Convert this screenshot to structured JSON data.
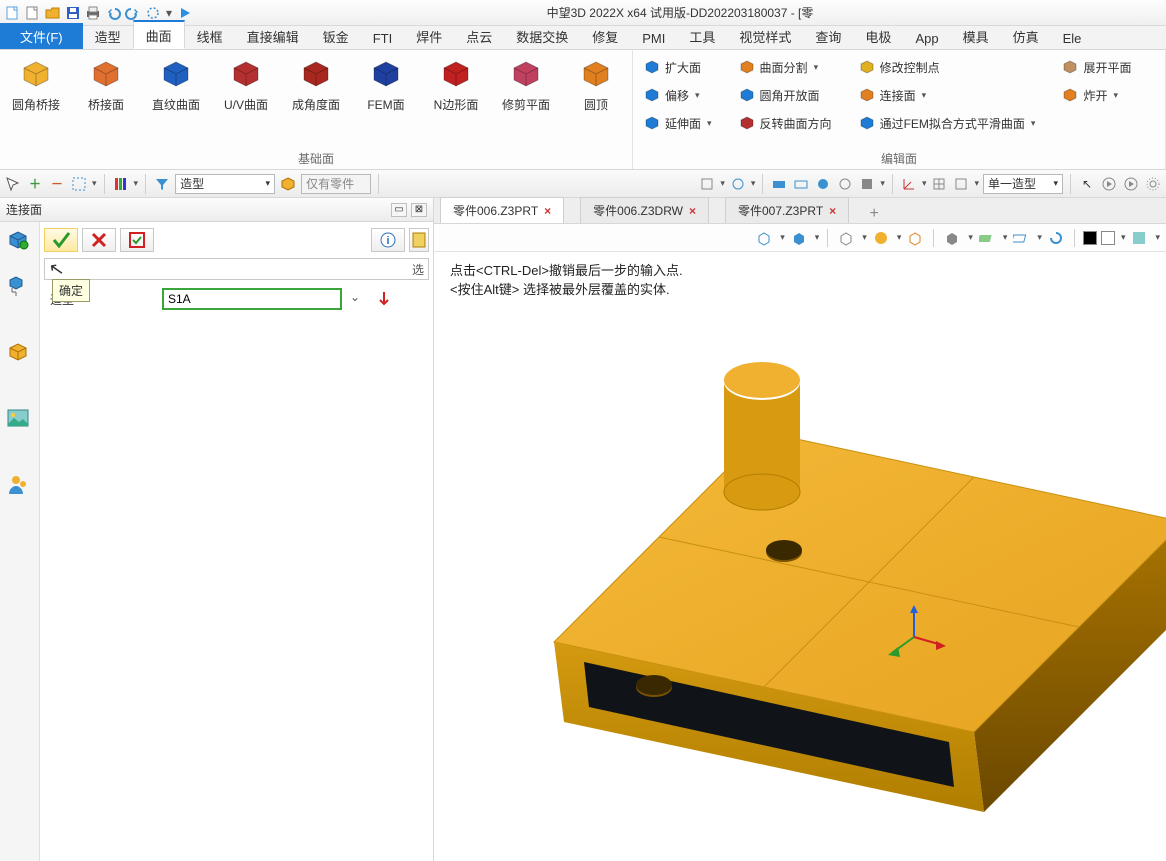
{
  "app": {
    "title": "中望3D 2022X x64 试用版-DD202203180037 - [零"
  },
  "qat": [
    "new",
    "new2",
    "open",
    "save",
    "print",
    "undo",
    "redo",
    "collab",
    "run"
  ],
  "menutabs": [
    {
      "id": "file",
      "label": "文件(F)",
      "type": "file"
    },
    {
      "id": "modeling",
      "label": "造型"
    },
    {
      "id": "surface",
      "label": "曲面",
      "active": true
    },
    {
      "id": "wireframe",
      "label": "线框"
    },
    {
      "id": "directedit",
      "label": "直接编辑"
    },
    {
      "id": "sheet",
      "label": "钣金"
    },
    {
      "id": "fti",
      "label": "FTI"
    },
    {
      "id": "weld",
      "label": "焊件"
    },
    {
      "id": "pointcloud",
      "label": "点云"
    },
    {
      "id": "dataex",
      "label": "数据交换"
    },
    {
      "id": "repair",
      "label": "修复"
    },
    {
      "id": "pmi",
      "label": "PMI"
    },
    {
      "id": "tool",
      "label": "工具"
    },
    {
      "id": "visual",
      "label": "视觉样式"
    },
    {
      "id": "query",
      "label": "查询"
    },
    {
      "id": "electrode",
      "label": "电极"
    },
    {
      "id": "app",
      "label": "App"
    },
    {
      "id": "mold",
      "label": "模具"
    },
    {
      "id": "simulate",
      "label": "仿真"
    },
    {
      "id": "ele",
      "label": "Ele"
    }
  ],
  "ribbon": {
    "group1_label": "基础面",
    "group2_label": "编辑面",
    "big": [
      {
        "id": "circbridge",
        "label": "圆角桥接",
        "color": "#f0b030"
      },
      {
        "id": "bridge",
        "label": "桥接面",
        "color": "#e07030"
      },
      {
        "id": "ruled",
        "label": "直纹曲面",
        "color": "#2060c0"
      },
      {
        "id": "uv",
        "label": "U/V曲面",
        "color": "#b43030"
      },
      {
        "id": "angle",
        "label": "成角度面",
        "color": "#a82820"
      },
      {
        "id": "fem",
        "label": "FEM面",
        "color": "#2040a0"
      },
      {
        "id": "nside",
        "label": "N边形面",
        "color": "#c02020"
      },
      {
        "id": "trim",
        "label": "修剪平面",
        "color": "#c04060"
      },
      {
        "id": "dome",
        "label": "圆顶",
        "color": "#e08020"
      }
    ],
    "small": [
      [
        {
          "id": "zoom",
          "label": "扩大面",
          "color": "#1e7cd6",
          "arrow": false
        },
        {
          "id": "offset",
          "label": "偏移",
          "color": "#1e7cd6",
          "arrow": true
        },
        {
          "id": "extend",
          "label": "延伸面",
          "color": "#1e7cd6",
          "arrow": true
        }
      ],
      [
        {
          "id": "split",
          "label": "曲面分割",
          "color": "#e08020",
          "arrow": true
        },
        {
          "id": "fillet",
          "label": "圆角开放面",
          "color": "#1e7cd6",
          "arrow": false
        },
        {
          "id": "reverse",
          "label": "反转曲面方向",
          "color": "#b43030",
          "arrow": false
        }
      ],
      [
        {
          "id": "ctrlpoint",
          "label": "修改控制点",
          "color": "#e0b020",
          "arrow": false
        },
        {
          "id": "connect",
          "label": "连接面",
          "color": "#e08020",
          "arrow": true
        },
        {
          "id": "femfit",
          "label": "通过FEM拟合方式平滑曲面",
          "color": "#1e7cd6",
          "arrow": true
        }
      ],
      [
        {
          "id": "unfold",
          "label": "展开平面",
          "color": "#c09060",
          "arrow": false,
          "trunc": "展开平面"
        },
        {
          "id": "explode",
          "label": "炸开",
          "color": "#e08020",
          "arrow": true
        }
      ]
    ]
  },
  "toolbar2": {
    "combo1": "造型",
    "combo2": "仅有零件",
    "combo3": "单一造型"
  },
  "panel": {
    "header": "连接面",
    "tooltip": "确定",
    "hint_trail": "选",
    "field_label": "造型",
    "field_value": "S1A"
  },
  "doctabs": [
    {
      "id": "t1",
      "label": "零件006.Z3PRT",
      "active": true
    },
    {
      "id": "t2",
      "label": "零件006.Z3DRW"
    },
    {
      "id": "t3",
      "label": "零件007.Z3PRT"
    }
  ],
  "hints": {
    "line1": "点击<CTRL-Del>撤销最后一步的输入点.",
    "line2": "<按住Alt键> 选择被最外层覆盖的实体."
  }
}
